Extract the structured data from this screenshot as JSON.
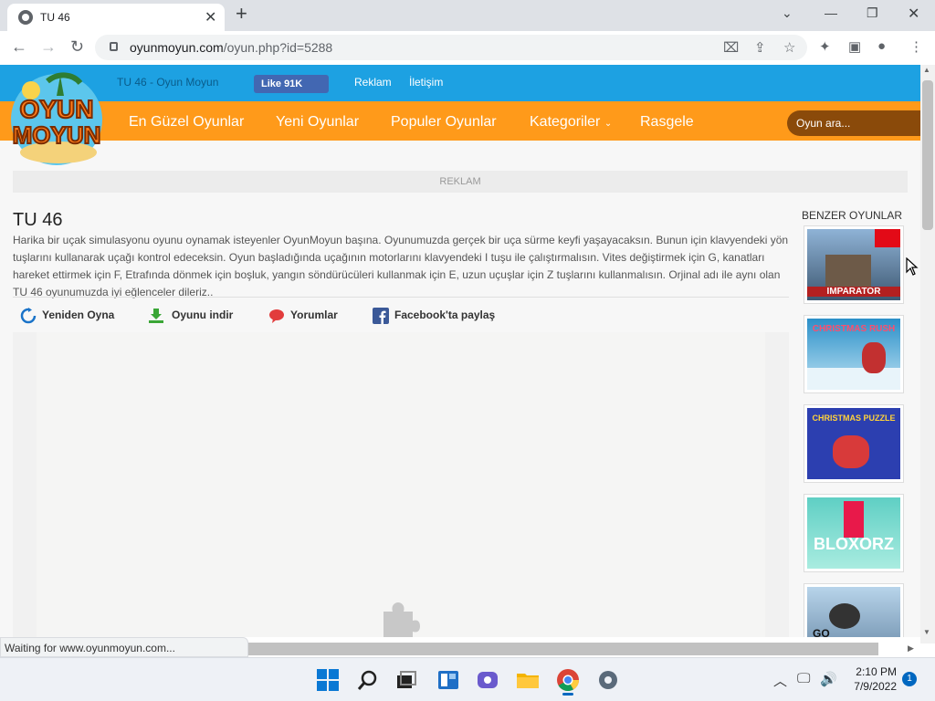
{
  "browser": {
    "tab_title": "TU 46",
    "new_tab_symbol": "+",
    "url_domain": "oyunmoyun.com",
    "url_path": "/oyun.php?id=5288"
  },
  "site": {
    "header_title": "TU 46 - Oyun Moyun",
    "like_label": "Like 91K",
    "top_links": [
      "Reklam",
      "İletişim"
    ],
    "nav": [
      "En Güzel Oyunlar",
      "Yeni Oyunlar",
      "Populer Oyunlar",
      "Kategoriler",
      "Rasgele"
    ],
    "search_placeholder": "Oyun ara...",
    "ad_label": "REKLAM",
    "logo_text": "OYUN MOYUN"
  },
  "game": {
    "title": "TU 46",
    "description": "Harika bir uçak simulasyonu oyunu oynamak isteyenler OyunMoyun başına. Oyunumuzda gerçek bir uça sürme keyfi yaşayacaksın. Bunun için klavyendeki yön tuşlarını kullanarak uçağı kontrol edeceksin. Oyun başladığında uçağının motorlarını klavyendeki I tuşu ile çalıştırmalısın. Vites değiştirmek için G, kanatları hareket ettirmek için F, Etrafında dönmek için boşluk, yangın söndürücüleri kullanmak için E, uzun uçuşlar için Z tuşlarını kullanmalısın. Orjinal adı ile aynı olan TU 46 oyunumuzda iyi eğlenceler dileriz..",
    "actions": [
      "Yeniden Oyna",
      "Oyunu indir",
      "Yorumlar",
      "Facebook'ta paylaş"
    ]
  },
  "sidebar": {
    "heading": "BENZER OYUNLAR",
    "games": [
      {
        "label": "IMPARATOR",
        "color": "#4a6b8a"
      },
      {
        "label": "CHRISTMAS RUSH",
        "color": "#2b8fc8"
      },
      {
        "label": "CHRISTMAS PUZZLE",
        "color": "#2c3fb0"
      },
      {
        "label": "BLOXORZ",
        "color": "#5fcfc4"
      },
      {
        "label": "GO",
        "color": "#8ab0d0"
      }
    ]
  },
  "status_text": "Waiting for www.oyunmoyun.com...",
  "taskbar": {
    "time": "2:10 PM",
    "date": "7/9/2022",
    "notification_count": "1"
  }
}
